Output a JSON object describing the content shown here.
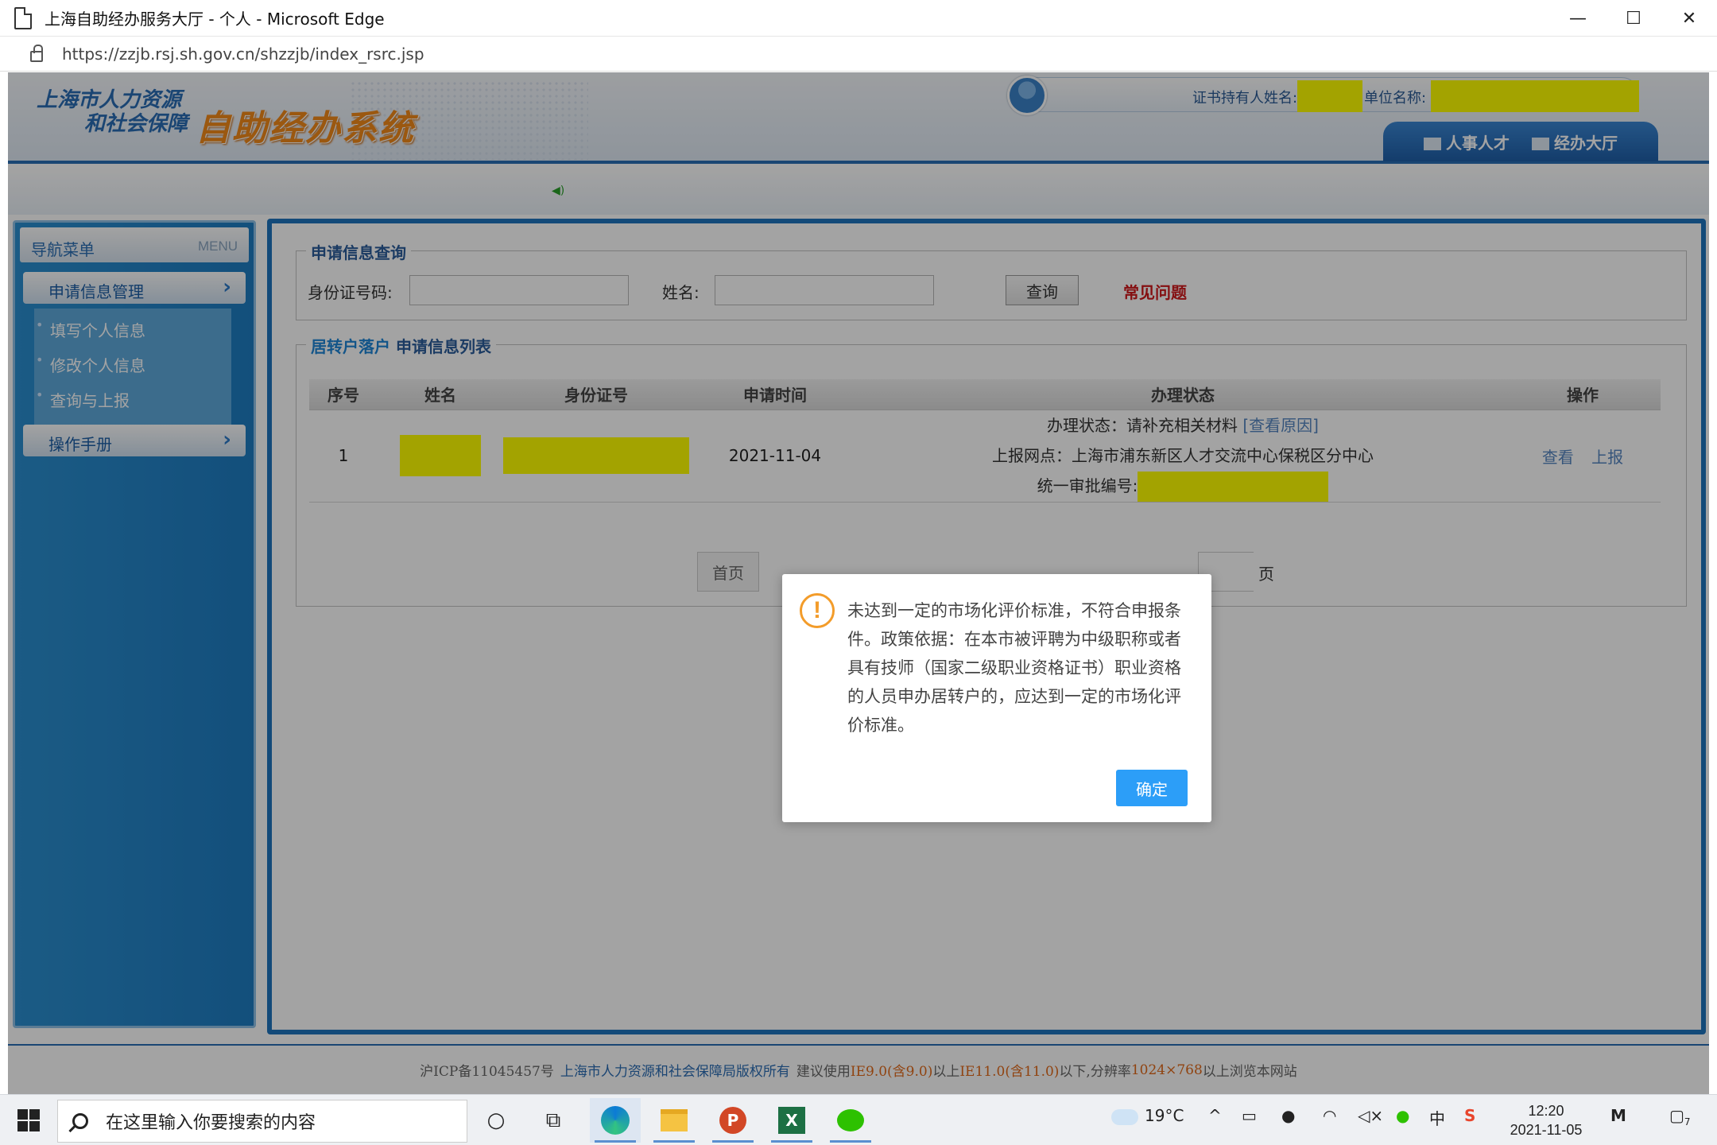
{
  "window": {
    "title": "上海自助经办服务大厅 - 个人 - Microsoft Edge",
    "url": "https://zzjb.rsj.sh.gov.cn/shzzjb/index_rsrc.jsp",
    "minimize": "—",
    "maximize": "☐",
    "close": "✕"
  },
  "header": {
    "logo_line1": "上海市人力资源",
    "logo_line2": "和社会保障",
    "system_name": "自助经办系统",
    "holder_label": "证书持有人姓名:",
    "unit_label": "单位名称:",
    "tab_talent": "人事人才",
    "tab_hall": "经办大厅"
  },
  "sidebar": {
    "title": "导航菜单",
    "title_en": "MENU",
    "group1": "申请信息管理",
    "items": [
      "填写个人信息",
      "修改个人信息",
      "查询与上报"
    ],
    "group2": "操作手册"
  },
  "query": {
    "legend": "申请信息查询",
    "id_label": "身份证号码:",
    "name_label": "姓名:",
    "button": "查询",
    "faq": "常见问题"
  },
  "list": {
    "legend_prefix": "居转户落户",
    "legend_suffix": "申请信息列表",
    "headers": [
      "序号",
      "姓名",
      "身份证号",
      "申请时间",
      "办理状态",
      "操作"
    ],
    "row": {
      "index": "1",
      "date": "2021-11-04",
      "status_line1": "办理状态：请补充相关材料",
      "status_link": "[查看原因]",
      "status_line2": "上报网点：上海市浦东新区人才交流中心保税区分中心",
      "status_line3": "统一审批编号:",
      "op_view": "查看",
      "op_report": "上报"
    },
    "pager_first": "首页",
    "pager_page": "页"
  },
  "dialog": {
    "message": "未达到一定的市场化评价标准，不符合申报条件。政策依据：在本市被评聘为中级职称或者具有技师（国家二级职业资格证书）职业资格的人员申办居转户的，应达到一定的市场化评价标准。",
    "ok": "确定"
  },
  "footer": {
    "icp": "沪ICP备11045457号",
    "copyright": "上海市人力资源和社会保障局版权所有",
    "advice_1": "建议使用",
    "ie9": "IE9.0(含9.0)",
    "advice_2": "以上",
    "ie11": "IE11.0(含11.0)",
    "advice_3": "以下,分辨率",
    "resolution": "1024×768",
    "advice_4": "以上浏览本网站"
  },
  "taskbar": {
    "search_placeholder": "在这里输入你要搜索的内容",
    "weather": "19°C",
    "ime": "中",
    "time": "12:20",
    "date": "2021-11-05",
    "notification_count": "7"
  }
}
